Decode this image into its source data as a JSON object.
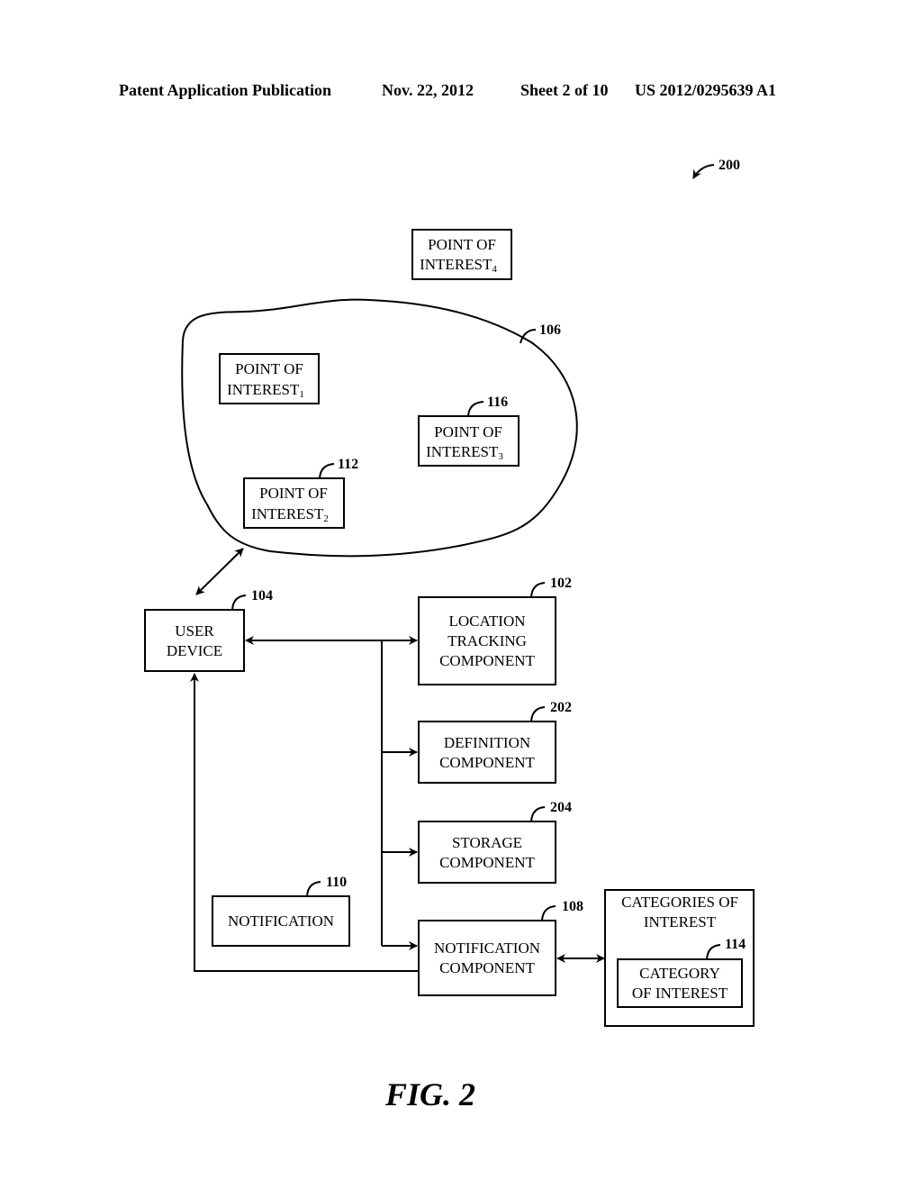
{
  "header": {
    "publication": "Patent Application Publication",
    "date": "Nov. 22, 2012",
    "sheet": "Sheet 2 of 10",
    "number": "US 2012/0295639 A1"
  },
  "figure_ref": "200",
  "figure_label": "FIG. 2",
  "region": {
    "ref": "106"
  },
  "poi": [
    {
      "line1": "POINT OF",
      "line2": "INTEREST",
      "sub": "1",
      "ref": ""
    },
    {
      "line1": "POINT OF",
      "line2": "INTEREST",
      "sub": "2",
      "ref": "112"
    },
    {
      "line1": "POINT OF",
      "line2": "INTEREST",
      "sub": "3",
      "ref": "116"
    },
    {
      "line1": "POINT OF",
      "line2": "INTEREST",
      "sub": "4",
      "ref": ""
    }
  ],
  "user_device": {
    "line1": "USER",
    "line2": "DEVICE",
    "ref": "104"
  },
  "location_tracking": {
    "line1": "LOCATION",
    "line2": "TRACKING",
    "line3": "COMPONENT",
    "ref": "102"
  },
  "definition": {
    "line1": "DEFINITION",
    "line2": "COMPONENT",
    "ref": "202"
  },
  "storage": {
    "line1": "STORAGE",
    "line2": "COMPONENT",
    "ref": "204"
  },
  "notification_component": {
    "line1": "NOTIFICATION",
    "line2": "COMPONENT",
    "ref": "108"
  },
  "notification": {
    "label": "NOTIFICATION",
    "ref": "110"
  },
  "categories": {
    "line1": "CATEGORIES OF",
    "line2": "INTEREST",
    "inner": {
      "line1": "CATEGORY",
      "line2": "OF INTEREST",
      "ref": "114"
    }
  }
}
